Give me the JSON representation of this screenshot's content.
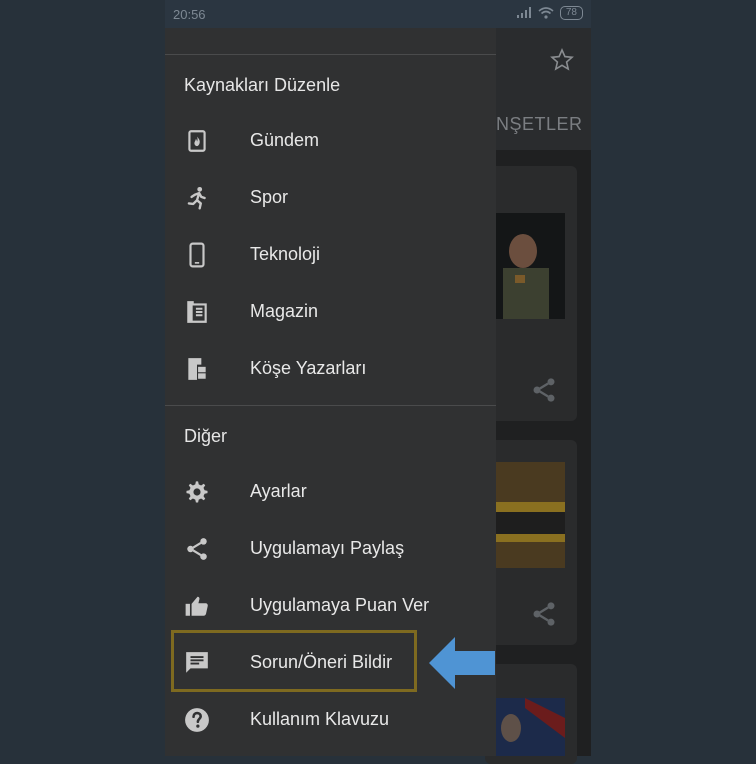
{
  "status": {
    "time": "20:56",
    "battery": "78"
  },
  "background": {
    "tab_label": "NŞETLER"
  },
  "drawer": {
    "section1": "Kaynakları Düzenle",
    "items1": [
      {
        "label": "Gündem",
        "icon": "fire-icon"
      },
      {
        "label": "Spor",
        "icon": "running-icon"
      },
      {
        "label": "Teknoloji",
        "icon": "phone-icon"
      },
      {
        "label": "Magazin",
        "icon": "book-icon"
      },
      {
        "label": "Köşe Yazarları",
        "icon": "columnist-icon"
      }
    ],
    "section2": "Diğer",
    "items2": [
      {
        "label": "Ayarlar",
        "icon": "gear-icon"
      },
      {
        "label": "Uygulamayı Paylaş",
        "icon": "share-icon"
      },
      {
        "label": "Uygulamaya Puan Ver",
        "icon": "thumbs-up-icon"
      },
      {
        "label": "Sorun/Öneri Bildir",
        "icon": "feedback-icon"
      },
      {
        "label": "Kullanım Klavuzu",
        "icon": "help-icon"
      }
    ]
  },
  "colors": {
    "highlight": "#7e6a20",
    "arrow": "#4f94d4"
  }
}
